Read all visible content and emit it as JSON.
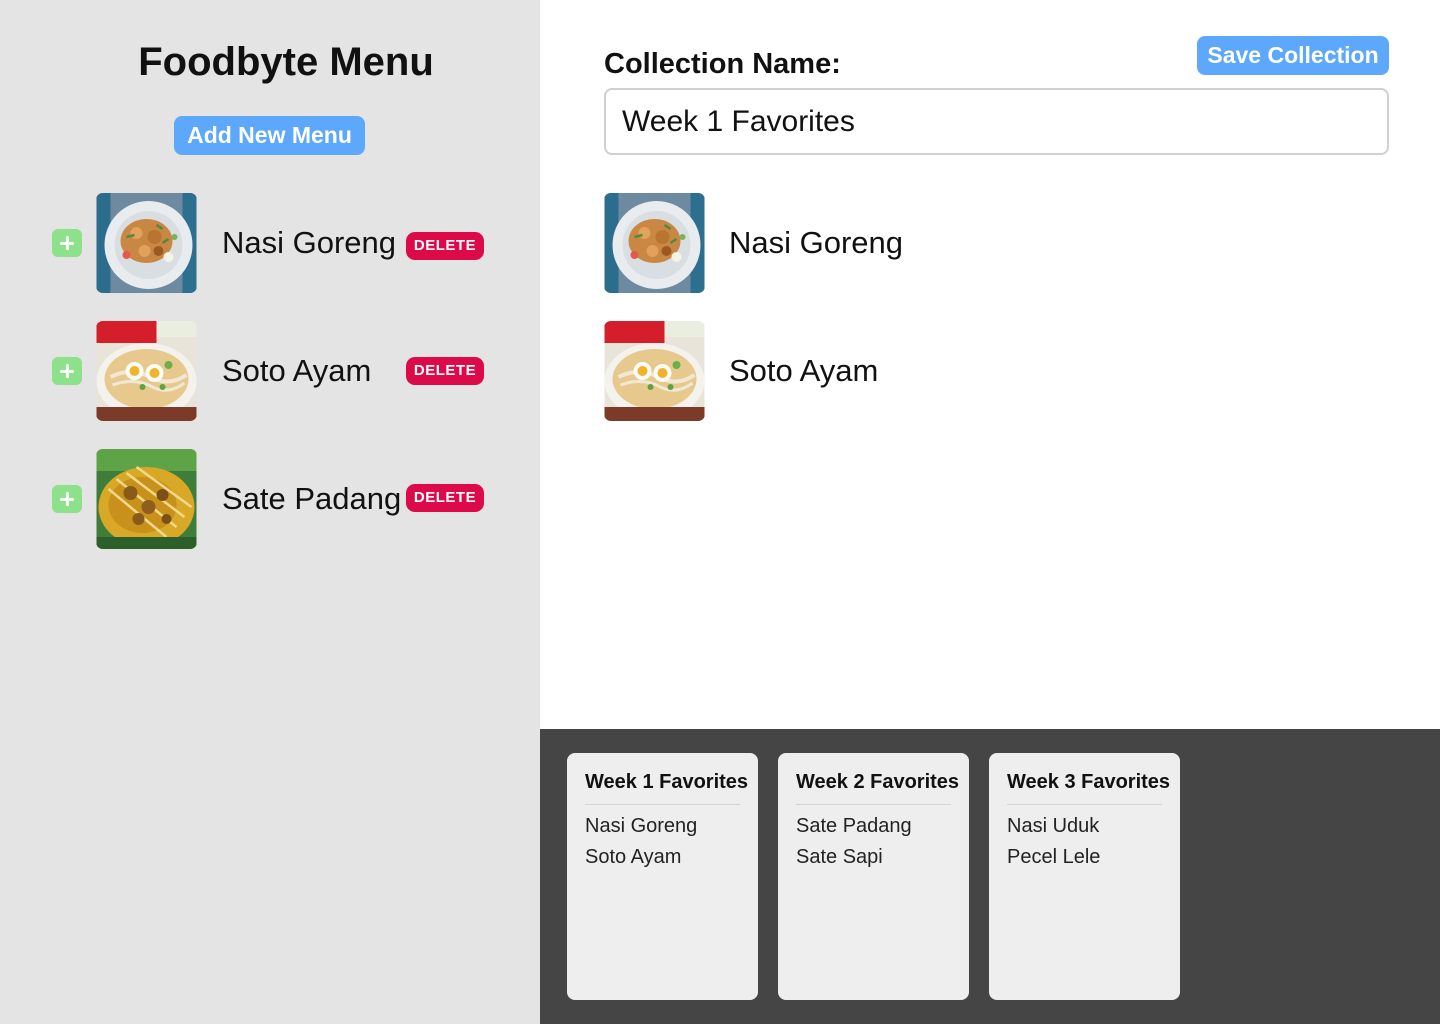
{
  "left": {
    "title": "Foodbyte Menu",
    "add_button": "Add New Menu",
    "items": [
      {
        "name": "Nasi Goreng",
        "delete_label": "DELETE",
        "image": "nasi-goreng-photo"
      },
      {
        "name": "Soto Ayam",
        "delete_label": "DELETE",
        "image": "soto-ayam-photo"
      },
      {
        "name": "Sate Padang",
        "delete_label": "DELETE",
        "image": "sate-padang-photo"
      }
    ]
  },
  "collection": {
    "label": "Collection Name:",
    "value": "Week 1 Favorites",
    "save_button": "Save Collection",
    "selected": [
      {
        "name": "Nasi Goreng",
        "image": "nasi-goreng-photo"
      },
      {
        "name": "Soto Ayam",
        "image": "soto-ayam-photo"
      }
    ]
  },
  "saved_collections": [
    {
      "title": "Week 1 Favorites",
      "items": [
        "Nasi Goreng",
        "Soto Ayam"
      ]
    },
    {
      "title": "Week 2 Favorites",
      "items": [
        "Sate Padang",
        "Sate Sapi"
      ]
    },
    {
      "title": "Week 3 Favorites",
      "items": [
        "Nasi Uduk",
        "Pecel Lele"
      ]
    }
  ],
  "colors": {
    "accent_blue": "#5ea8fb",
    "delete_red": "#dc0a48",
    "add_green": "#8ce18a",
    "left_bg": "#e4e4e4",
    "bottom_bg": "#454545"
  }
}
